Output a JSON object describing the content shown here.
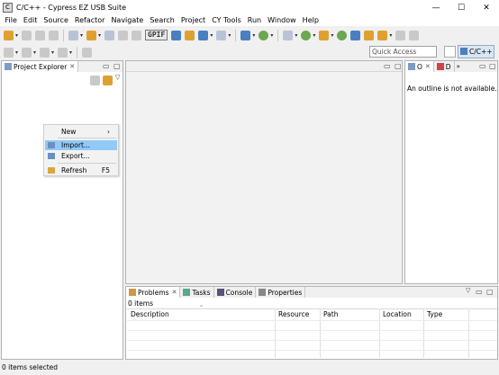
{
  "window": {
    "title": "C/C++ - Cypress EZ USB Suite",
    "minimize": "—",
    "maximize": "☐",
    "close": "✕"
  },
  "menu": [
    "File",
    "Edit",
    "Source",
    "Refactor",
    "Navigate",
    "Search",
    "Project",
    "CY Tools",
    "Run",
    "Window",
    "Help"
  ],
  "toolbar": {
    "gpif_label": "GPIF",
    "quick_access_placeholder": "Quick Access",
    "perspective_label": "C/C++"
  },
  "project_explorer": {
    "tab_label": "Project Explorer",
    "close": "✕",
    "minimize": "▭",
    "maximize": "▢"
  },
  "context_menu": {
    "new": "New",
    "new_arrow": "›",
    "import": "Import...",
    "export": "Export...",
    "refresh": "Refresh",
    "refresh_shortcut": "F5"
  },
  "outline": {
    "tab_o": "O",
    "tab_d": "D",
    "message": "An outline is not available."
  },
  "problems_panel": {
    "tabs": [
      "Problems",
      "Tasks",
      "Console",
      "Properties"
    ],
    "item_count": "0 items",
    "columns": [
      "Description",
      "Resource",
      "Path",
      "Location",
      "Type"
    ]
  },
  "status": {
    "text": "0 items selected"
  }
}
